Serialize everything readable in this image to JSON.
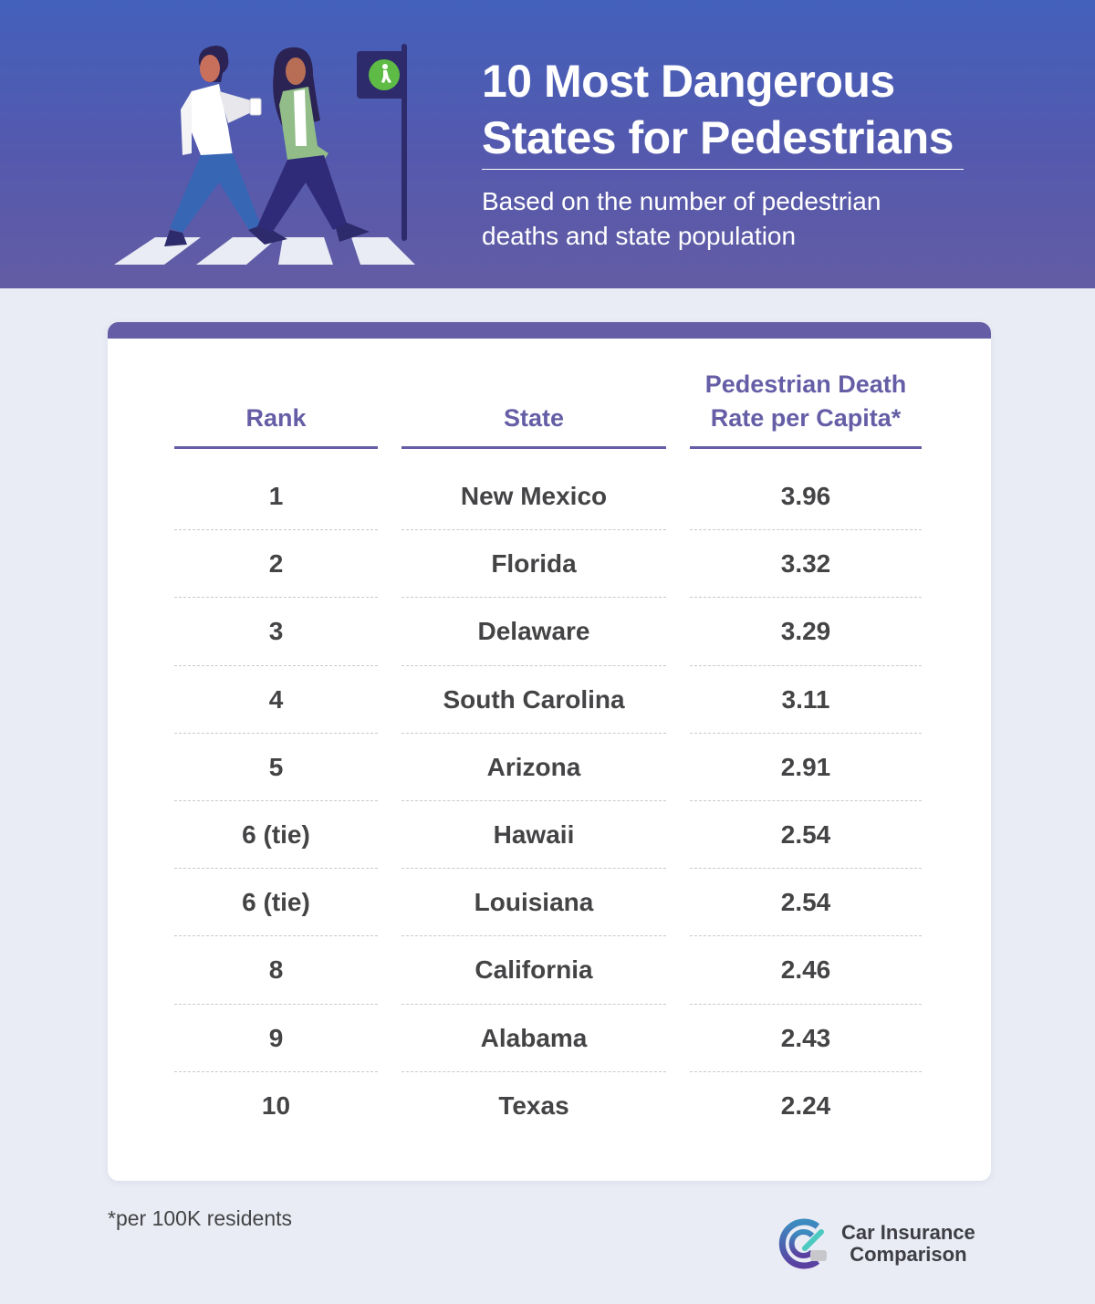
{
  "header": {
    "title_line1": "10 Most Dangerous",
    "title_line2": "States for Pedestrians",
    "subtitle_line1": "Based on the number of pedestrian",
    "subtitle_line2": "deaths and state population",
    "illustration": "two-pedestrians-crossing-crosswalk-with-walk-signal",
    "signal_icon": "pedestrian-walk-icon"
  },
  "colors": {
    "header_top": "#4360bb",
    "header_bottom": "#635ca4",
    "accent": "#655ea6",
    "background": "#e9ecf4",
    "text": "#444446",
    "signal_green": "#5dbb46"
  },
  "table": {
    "columns": [
      "Rank",
      "State",
      "Pedestrian Death Rate per Capita*"
    ],
    "column_header_rate_line1": "Pedestrian Death",
    "column_header_rate_line2": "Rate per Capita*",
    "rows": [
      {
        "rank": "1",
        "state": "New Mexico",
        "rate": "3.96"
      },
      {
        "rank": "2",
        "state": "Florida",
        "rate": "3.32"
      },
      {
        "rank": "3",
        "state": "Delaware",
        "rate": "3.29"
      },
      {
        "rank": "4",
        "state": "South Carolina",
        "rate": "3.11"
      },
      {
        "rank": "5",
        "state": "Arizona",
        "rate": "2.91"
      },
      {
        "rank": "6 (tie)",
        "state": "Hawaii",
        "rate": "2.54"
      },
      {
        "rank": "6 (tie)",
        "state": "Louisiana",
        "rate": "2.54"
      },
      {
        "rank": "8",
        "state": "California",
        "rate": "2.46"
      },
      {
        "rank": "9",
        "state": "Alabama",
        "rate": "2.43"
      },
      {
        "rank": "10",
        "state": "Texas",
        "rate": "2.24"
      }
    ]
  },
  "footnote": "*per 100K residents",
  "brand": {
    "line1": "Car Insurance",
    "line2": "Comparison",
    "logo_icon": "cic-logo-icon"
  }
}
